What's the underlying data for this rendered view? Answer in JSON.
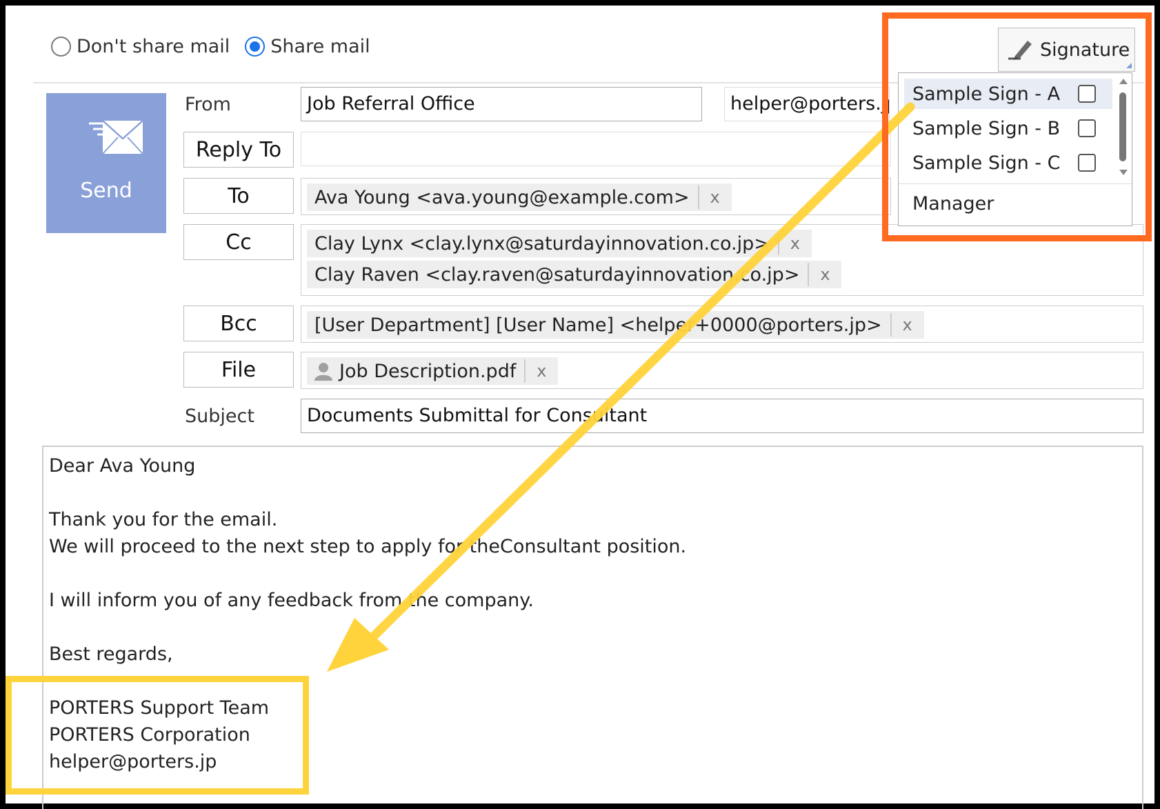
{
  "share": {
    "options": [
      {
        "label": "Don't share mail",
        "checked": false
      },
      {
        "label": "Share mail",
        "checked": true
      }
    ]
  },
  "send": {
    "label": "Send"
  },
  "fields": {
    "from_label": "From",
    "from_value": "Job Referral Office",
    "from_email": "helper@porters.jp",
    "reply_to_label": "Reply To",
    "reply_to_value": "",
    "to_label": "To",
    "to_tokens": [
      "Ava Young <ava.young@example.com>"
    ],
    "cc_label": "Cc",
    "cc_tokens": [
      "Clay Lynx <clay.lynx@saturdayinnovation.co.jp>",
      "Clay Raven <clay.raven@saturdayinnovation.co.jp>"
    ],
    "bcc_label": "Bcc",
    "bcc_tokens": [
      "[User Department] [User Name] <helper+0000@porters.jp>"
    ],
    "file_label": "File",
    "file_tokens": [
      "Job Description.pdf"
    ],
    "subject_label": "Subject",
    "subject_value": "Documents Submittal for Consultant",
    "remove_glyph": "x"
  },
  "body": {
    "lines": [
      "Dear Ava Young",
      "Thank you for the email.",
      "We will proceed to the next step to apply for theConsultant position.",
      "I will inform you of any feedback from the company.",
      "Best regards,",
      "PORTERS Support Team",
      "PORTERS Corporation",
      "helper@porters.jp"
    ]
  },
  "signature": {
    "button_label": "Signature",
    "items": [
      {
        "label": "Sample Sign - A",
        "checked": false,
        "highlighted": true
      },
      {
        "label": "Sample Sign - B",
        "checked": false,
        "highlighted": false
      },
      {
        "label": "Sample Sign - C",
        "checked": false,
        "highlighted": false
      }
    ],
    "group_label": "Manager"
  },
  "colors": {
    "send_bg": "#8aa0d8",
    "radio_accent": "#1a73e8",
    "annotation_orange": "#ff6a21",
    "annotation_yellow": "#ffd33b"
  },
  "icons": [
    "envelope-icon",
    "pen-icon",
    "user-file-icon",
    "remove-icon",
    "scroll-up-icon",
    "scroll-down-icon"
  ]
}
